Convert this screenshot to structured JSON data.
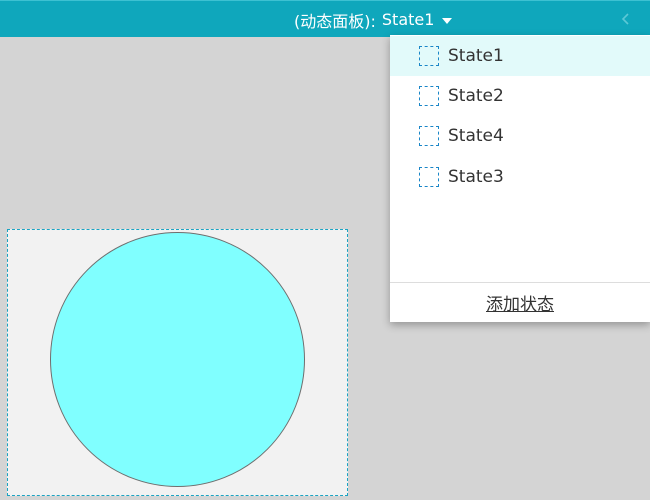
{
  "toolbar": {
    "panel_label": "(动态面板):",
    "current_state": "State1",
    "collapse_icon": "chevron-left-icon"
  },
  "state_menu": {
    "items": [
      {
        "label": "State1",
        "icon": "state-page-icon",
        "selected": true
      },
      {
        "label": "State2",
        "icon": "state-page-icon",
        "selected": false
      },
      {
        "label": "State4",
        "icon": "state-page-icon",
        "selected": false
      },
      {
        "label": "State3",
        "icon": "state-page-icon",
        "selected": false
      }
    ],
    "add_label": "添加状态"
  },
  "colors": {
    "topbar": "#0fa7bc",
    "selected_row": "#e2fafa",
    "circle_fill": "#80ffff",
    "panel_border": "#1aa3c2"
  }
}
